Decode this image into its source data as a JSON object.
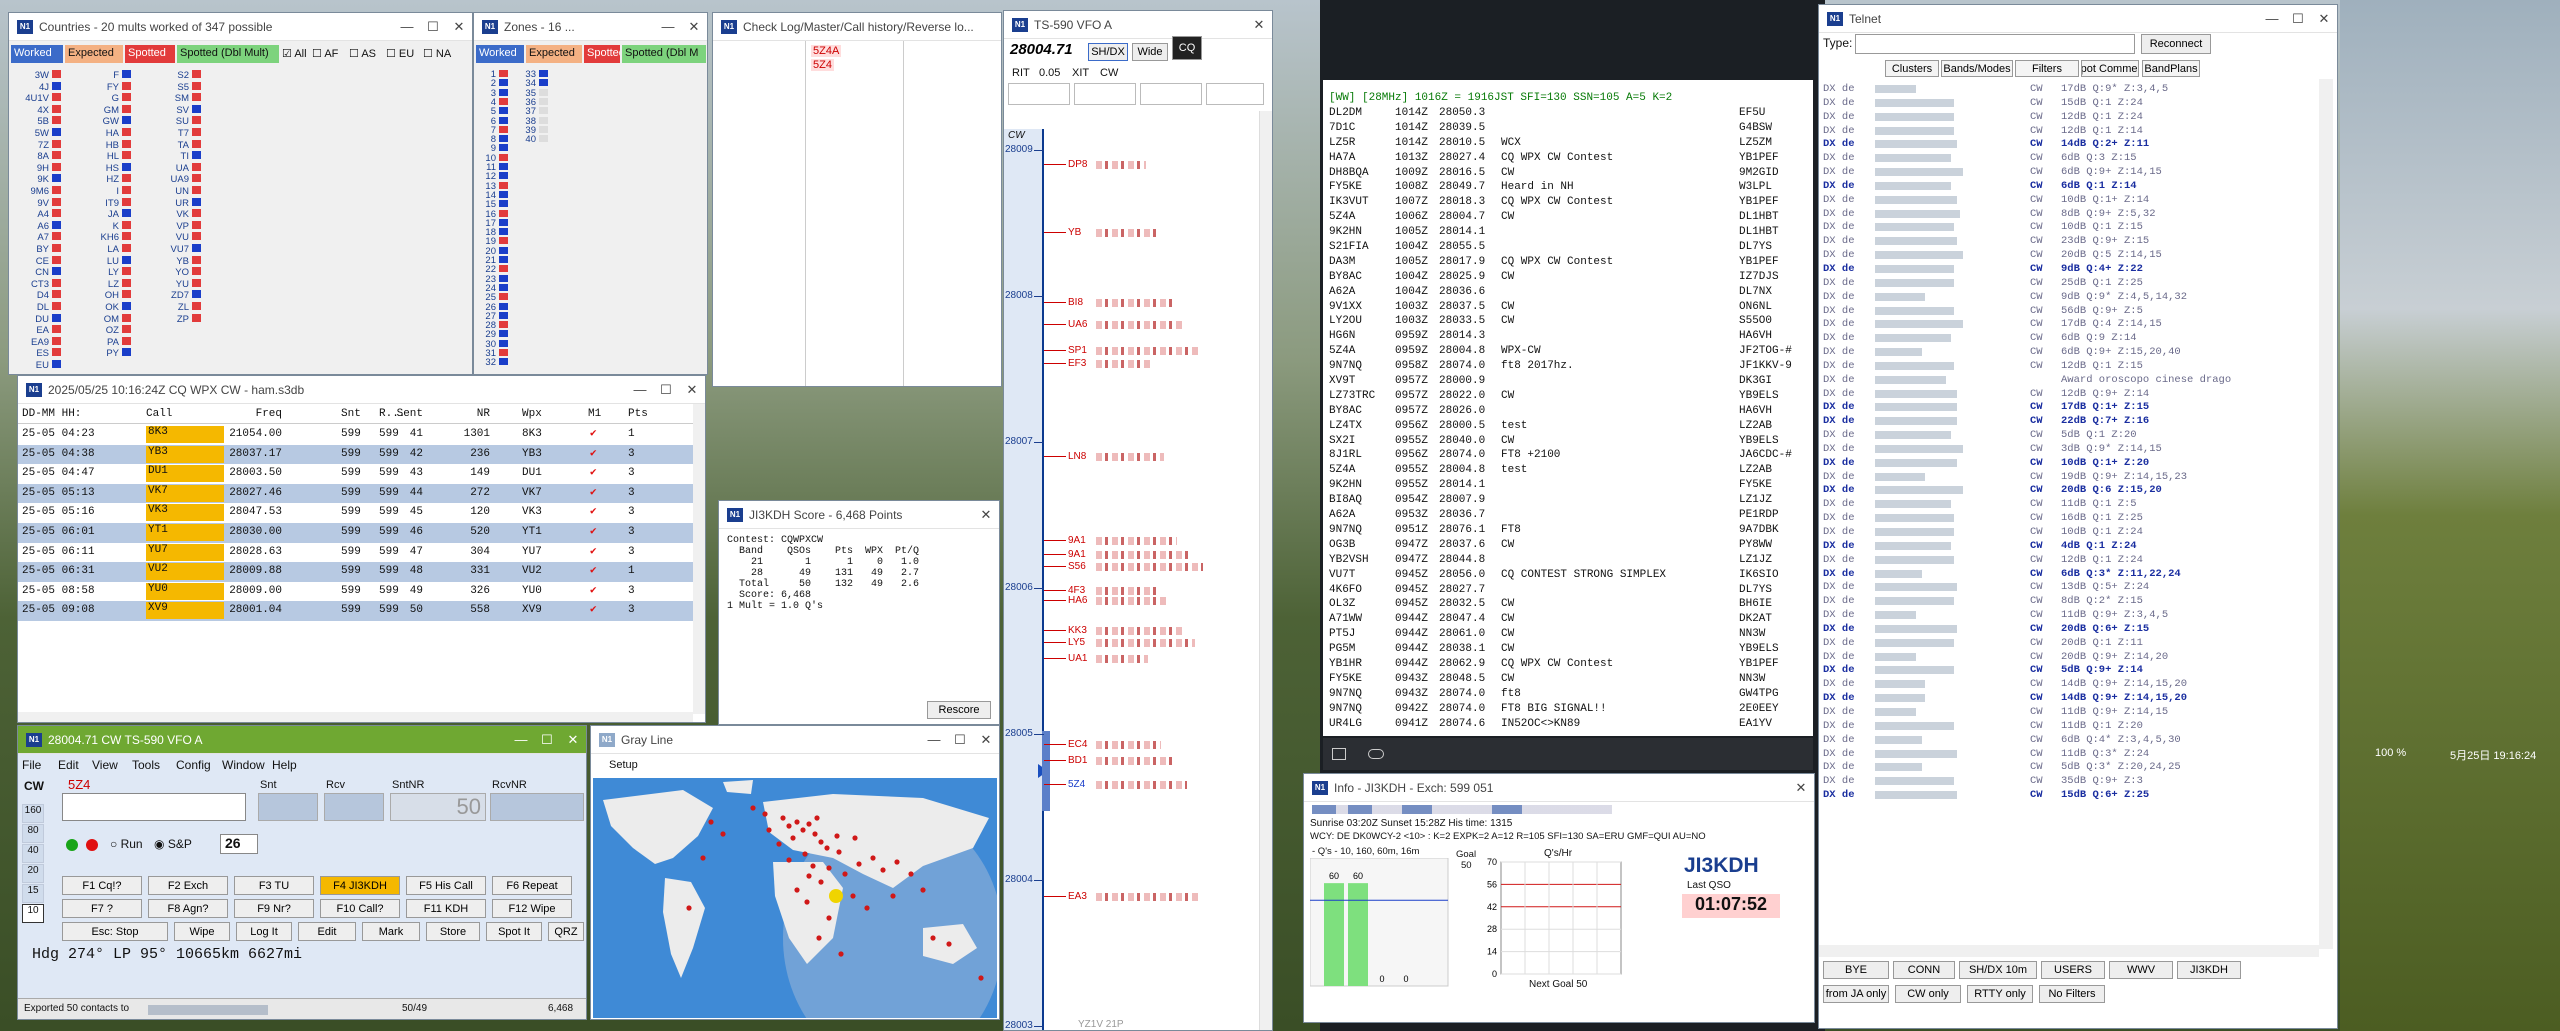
{
  "colors": {
    "accent": "#1a3e8f",
    "green_title": "#6fa832",
    "row_sel": "#b7c9e2",
    "call_hi": "#f5b800",
    "check_red": "#e01010",
    "red": "#c00000"
  },
  "countries": {
    "title": "Countries - 20 mults worked of 347 possible",
    "filters": [
      "Worked",
      "Expected",
      "Spotted",
      "Spotted (Dbl Mult)",
      "All",
      "AF",
      "AS",
      "EU",
      "NA"
    ],
    "col1": [
      "3W",
      "4J",
      "4U1V",
      "4X",
      "5B",
      "5W",
      "7Z",
      "8A",
      "9H",
      "9K",
      "9M6",
      "9V",
      "A4",
      "A6",
      "A7",
      "BY",
      "CE",
      "CN",
      "CT3",
      "D4",
      "DL",
      "DU",
      "EA",
      "EA9",
      "ES",
      "EU"
    ],
    "col2": [
      "F",
      "FY",
      "G",
      "GM",
      "GW",
      "HA",
      "HB",
      "HL",
      "HS",
      "HZ",
      "I",
      "IT9",
      "JA",
      "K",
      "KH6",
      "LA",
      "LU",
      "LY",
      "LZ",
      "OH",
      "OK",
      "OM",
      "OZ",
      "PA",
      "PY"
    ],
    "col3": [
      "S2",
      "S5",
      "SM",
      "SV",
      "SU",
      "T7",
      "TA",
      "TI",
      "UA",
      "UA9",
      "UN",
      "UR",
      "VK",
      "VP",
      "VU",
      "VU7",
      "YB",
      "YO",
      "YU",
      "ZD7",
      "ZL",
      "ZP"
    ]
  },
  "zones": {
    "title": "Zones - 16 ...",
    "filters": [
      "Worked",
      "Expected",
      "Spotted",
      "Spotted (Dbl M"
    ],
    "col1": [
      "1",
      "2",
      "3",
      "4",
      "5",
      "6",
      "7",
      "8",
      "9",
      "10",
      "11",
      "12",
      "13",
      "14",
      "15",
      "16",
      "17",
      "18",
      "19",
      "20",
      "21",
      "22",
      "23",
      "24",
      "25",
      "26",
      "27",
      "28",
      "29",
      "30",
      "31",
      "32"
    ],
    "col2": [
      "33",
      "34",
      "35",
      "36",
      "37",
      "38",
      "39",
      "40"
    ]
  },
  "checklog": {
    "title": "Check Log/Master/Call history/Reverse lo...",
    "items": [
      "5Z4A",
      "5Z4"
    ]
  },
  "bandmap": {
    "title": "TS-590 VFO A",
    "freq": "28004.71",
    "btn_shdx": "SH/DX",
    "btn_wide": "Wide",
    "btn_cq": "CQ",
    "rit": "RIT",
    "rit_val": "0.05",
    "xit": "XIT",
    "mode": "CW",
    "mode_label": "CW",
    "ticks": [
      "28009",
      "28008",
      "28007",
      "28006",
      "28005",
      "28004",
      "28003"
    ],
    "spots": [
      "DP8",
      "YB",
      "BI8",
      "UA6",
      "SP1",
      "EF3",
      "LN8",
      "9A1",
      "9A1",
      "S56",
      "4F3",
      "HA6",
      "KK3",
      "LY5",
      "UA1",
      "EC4",
      "BD1",
      "5Z4",
      "EA3"
    ],
    "bottom": "YZ1V 21P"
  },
  "log": {
    "title": "2025/05/25 10:16:24Z  CQ WPX  CW - ham.s3db",
    "headers": [
      "DD-MM  HH:MM",
      "Call",
      "Freq",
      "Snt",
      "R...",
      "Sent",
      "NR",
      "Wpx",
      "M1",
      "Pts"
    ],
    "rows": [
      {
        "dt": "25-05 04:23",
        "call": "8K3",
        "freq": "21054.00",
        "snt": "599",
        "rcv": "599",
        "sent": "41",
        "nr": "1301",
        "wpx": "8K3",
        "pts": "1"
      },
      {
        "dt": "25-05 04:38",
        "call": "YB3",
        "freq": "28037.17",
        "snt": "599",
        "rcv": "599",
        "sent": "42",
        "nr": "236",
        "wpx": "YB3",
        "pts": "3"
      },
      {
        "dt": "25-05 04:47",
        "call": "DU1",
        "freq": "28003.50",
        "snt": "599",
        "rcv": "599",
        "sent": "43",
        "nr": "149",
        "wpx": "DU1",
        "pts": "3"
      },
      {
        "dt": "25-05 05:13",
        "call": "VK7",
        "freq": "28027.46",
        "snt": "599",
        "rcv": "599",
        "sent": "44",
        "nr": "272",
        "wpx": "VK7",
        "pts": "3"
      },
      {
        "dt": "25-05 05:16",
        "call": "VK3",
        "freq": "28047.53",
        "snt": "599",
        "rcv": "599",
        "sent": "45",
        "nr": "120",
        "wpx": "VK3",
        "pts": "3"
      },
      {
        "dt": "25-05 06:01",
        "call": "YT1",
        "freq": "28030.00",
        "snt": "599",
        "rcv": "599",
        "sent": "46",
        "nr": "520",
        "wpx": "YT1",
        "pts": "3"
      },
      {
        "dt": "25-05 06:11",
        "call": "YU7",
        "freq": "28028.63",
        "snt": "599",
        "rcv": "599",
        "sent": "47",
        "nr": "304",
        "wpx": "YU7",
        "pts": "3"
      },
      {
        "dt": "25-05 06:31",
        "call": "VU2",
        "freq": "28009.88",
        "snt": "599",
        "rcv": "599",
        "sent": "48",
        "nr": "331",
        "wpx": "VU2",
        "pts": "1"
      },
      {
        "dt": "25-05 08:58",
        "call": "YU0",
        "freq": "28009.00",
        "snt": "599",
        "rcv": "599",
        "sent": "49",
        "nr": "326",
        "wpx": "YU0",
        "pts": "3"
      },
      {
        "dt": "25-05 09:08",
        "call": "XV9",
        "freq": "28001.04",
        "snt": "599",
        "rcv": "599",
        "sent": "50",
        "nr": "558",
        "wpx": "XV9",
        "pts": "3"
      }
    ]
  },
  "score": {
    "title": "JI3KDH Score - 6,468 Points",
    "lines": [
      "Contest: CQWPXCW",
      "  Band    QSOs    Pts  WPX  Pt/Q",
      "    21       1      1    0   1.0",
      "    28      49    131   49   2.7",
      "  Total     50    132   49   2.6",
      "  Score: 6,468",
      "1 Mult = 1.0 Q's"
    ],
    "rescore": "Rescore"
  },
  "entry": {
    "title": "28004.71 CW TS-590 VFO A",
    "menu": [
      "File",
      "Edit",
      "View",
      "Tools",
      "Config",
      "Window",
      "Help"
    ],
    "callsign": "5Z4",
    "labels": [
      "Snt",
      "Rcv",
      "SntNR",
      "RcvNR"
    ],
    "sntnr": "50",
    "mode": "CW",
    "bands": [
      "160",
      "80",
      "40",
      "20",
      "15",
      "10"
    ],
    "run": "Run",
    "sp": "S&P",
    "spin": "26",
    "fkeys": [
      "F1 Cq!?",
      "F2 Exch",
      "F3 TU",
      "F4 JI3KDH",
      "F5 His Call",
      "F6 Repeat",
      "F7 ?",
      "F8 Agn?",
      "F9 Nr?",
      "F10 Call?",
      "F11 KDH",
      "F12 Wipe"
    ],
    "actions": [
      "Esc: Stop",
      "Wipe",
      "Log It",
      "Edit",
      "Mark",
      "Store",
      "Spot It",
      "QRZ"
    ],
    "heading": "Hdg 274° LP 95° 10665km 6627mi",
    "status": "Exported 50 contacts to",
    "count": "50/49",
    "pts": "6,468"
  },
  "grayline": {
    "title": "Gray Line",
    "setup": "Setup"
  },
  "cluster": {
    "header": "[WW] [28MHz] 1016Z = 1916JST  SFI=130 SSN=105 A=5 K=2",
    "rows": [
      [
        "DL2DM",
        "1014Z",
        "28050.3",
        "",
        "EF5U"
      ],
      [
        "7D1C",
        "1014Z",
        "28039.5",
        "",
        "G4BSW"
      ],
      [
        "LZ5R",
        "1014Z",
        "28010.5",
        "WCX",
        "LZ5ZM"
      ],
      [
        "HA7A",
        "1013Z",
        "28027.4",
        "CQ WPX CW Contest",
        "YB1PEF"
      ],
      [
        "DH8BQA",
        "1009Z",
        "28016.5",
        "CW",
        "9M2GID"
      ],
      [
        "FY5KE",
        "1008Z",
        "28049.7",
        "Heard in NH",
        "W3LPL"
      ],
      [
        "IK3VUT",
        "1007Z",
        "28018.3",
        "CQ WPX CW Contest",
        "YB1PEF"
      ],
      [
        "5Z4A",
        "1006Z",
        "28004.7",
        "CW",
        "DL1HBT"
      ],
      [
        "9K2HN",
        "1005Z",
        "28014.1",
        "",
        "DL1HBT"
      ],
      [
        "S21FIA",
        "1004Z",
        "28055.5",
        "",
        "DL7YS"
      ],
      [
        "DA3M",
        "1005Z",
        "28017.9",
        "CQ WPX CW Contest",
        "YB1PEF"
      ],
      [
        "BY8AC",
        "1004Z",
        "28025.9",
        "CW",
        "IZ7DJS"
      ],
      [
        "A62A",
        "1004Z",
        "28036.6",
        "",
        "DL7NX"
      ],
      [
        "9V1XX",
        "1003Z",
        "28037.5",
        "CW",
        "ON6NL"
      ],
      [
        "LY2OU",
        "1003Z",
        "28033.5",
        "CW",
        "S55O0"
      ],
      [
        "HG6N",
        "0959Z",
        "28014.3",
        "",
        "HA6VH"
      ],
      [
        "5Z4A",
        "0959Z",
        "28004.8",
        "WPX-CW",
        "JF2TOG-#"
      ],
      [
        "9N7NQ",
        "0958Z",
        "28074.0",
        "ft8 2017hz.",
        "JF1KKV-9"
      ],
      [
        "XV9T",
        "0957Z",
        "28000.9",
        "",
        "DK3GI"
      ],
      [
        "LZ73TRC",
        "0957Z",
        "28022.0",
        "CW",
        "YB9ELS"
      ],
      [
        "BY8AC",
        "0957Z",
        "28026.0",
        "",
        "HA6VH"
      ],
      [
        "LZ4TX",
        "0956Z",
        "28000.5",
        "test",
        "LZ2AB"
      ],
      [
        "SX2I",
        "0955Z",
        "28040.0",
        "CW",
        "YB9ELS"
      ],
      [
        "8J1RL",
        "0956Z",
        "28074.0",
        "FT8 +2100",
        "JA6CDC-#"
      ],
      [
        "5Z4A",
        "0955Z",
        "28004.8",
        "test",
        "LZ2AB"
      ],
      [
        "9K2HN",
        "0955Z",
        "28014.1",
        "",
        "FY5KE"
      ],
      [
        "BI8AQ",
        "0954Z",
        "28007.9",
        "",
        "LZ1JZ"
      ],
      [
        "A62A",
        "0953Z",
        "28036.7",
        "",
        "PE1RDP"
      ],
      [
        "9N7NQ",
        "0951Z",
        "28076.1",
        "FT8",
        "9A7DBK"
      ],
      [
        "OG3B",
        "0947Z",
        "28037.6",
        "CW",
        "PY8WW"
      ],
      [
        "YB2VSH",
        "0947Z",
        "28044.8",
        "",
        "LZ1JZ"
      ],
      [
        "VU7T",
        "0945Z",
        "28056.0",
        "CQ CONTEST STRONG SIMPLEX",
        "IK6SIO"
      ],
      [
        "4K6FO",
        "0945Z",
        "28027.7",
        "",
        "DL7YS"
      ],
      [
        "OL3Z",
        "0945Z",
        "28032.5",
        "CW",
        "BH6IE"
      ],
      [
        "A71WW",
        "0944Z",
        "28047.4",
        "CW",
        "DK2AT"
      ],
      [
        "PT5J",
        "0944Z",
        "28061.0",
        "CW",
        "NN3W"
      ],
      [
        "PG5M",
        "0944Z",
        "28038.1",
        "CW",
        "YB9ELS"
      ],
      [
        "YB1HR",
        "0944Z",
        "28062.9",
        "CQ WPX CW Contest",
        "YB1PEF"
      ],
      [
        "FY5KE",
        "0943Z",
        "28048.5",
        "CW",
        "NN3W"
      ],
      [
        "9N7NQ",
        "0943Z",
        "28074.0",
        "ft8",
        "GW4TPG"
      ],
      [
        "9N7NQ",
        "0942Z",
        "28074.0",
        "FT8 BIG SIGNAL!!",
        "2E0EEY"
      ],
      [
        "UR4LG",
        "0941Z",
        "28074.6",
        "IN52OC<>KN89",
        "EA1YV"
      ]
    ]
  },
  "info": {
    "title": "Info - JI3KDH - Exch: 599 051",
    "sun": "Sunrise 03:20Z Sunset 15:28Z His time: 1315",
    "wcy": "WCY: DE DK0WCY-2 <10> : K=2 EXPK=2 A=12 R=105 SFI=130 SA=ERU GMF=QUI AU=NO",
    "qs_label": "- Q's - 10, 160, 60m, 16m",
    "goal_label": "Goal",
    "goal": "50",
    "bars": [
      60,
      60,
      0,
      0
    ],
    "bar_labels": [
      "60",
      "60",
      "0",
      "0"
    ],
    "rate_label": "Q's/Hr",
    "rate_ticks": [
      "70",
      "56",
      "42",
      "28",
      "14",
      "0"
    ],
    "next_goal": "Next Goal 50",
    "callsign": "JI3KDH",
    "last_qso": "Last QSO",
    "timer": "01:07:52"
  },
  "telnet": {
    "title": "Telnet",
    "type_label": "Type:",
    "reconnect": "Reconnect",
    "tabs": [
      "Clusters",
      "Bands/Modes",
      "Filters",
      "Spot Comment",
      "BandPlans"
    ],
    "lines": [
      [
        "CW",
        "17dB Q:9* Z:3,4,5",
        0
      ],
      [
        "CW",
        "15dB Q:1 Z:24",
        0
      ],
      [
        "CW",
        "12dB Q:1 Z:24",
        0
      ],
      [
        "CW",
        "12dB Q:1 Z:14",
        0
      ],
      [
        "CW",
        "14dB Q:2+ Z:11",
        1
      ],
      [
        "CW",
        "6dB Q:3 Z:15",
        0
      ],
      [
        "CW",
        "6dB Q:9+ Z:14,15",
        0
      ],
      [
        "CW",
        "6dB Q:1 Z:14",
        1
      ],
      [
        "CW",
        "10dB Q:1+ Z:14",
        0
      ],
      [
        "CW",
        "8dB Q:9+ Z:5,32",
        0
      ],
      [
        "CW",
        "10dB Q:1 Z:15",
        0
      ],
      [
        "CW",
        "23dB Q:9+ Z:15",
        0
      ],
      [
        "CW",
        "20dB Q:5 Z:14,15",
        0
      ],
      [
        "CW",
        "9dB Q:4+ Z:22",
        1
      ],
      [
        "CW",
        "25dB Q:1 Z:25",
        0
      ],
      [
        "CW",
        "9dB Q:9* Z:4,5,14,32",
        0
      ],
      [
        "CW",
        "56dB Q:9+ Z:5",
        0
      ],
      [
        "CW",
        "17dB Q:4 Z:14,15",
        0
      ],
      [
        "CW",
        "6dB Q:9 Z:14",
        0
      ],
      [
        "CW",
        "6dB Q:9+ Z:15,20,40",
        0
      ],
      [
        "CW",
        "12dB Q:1 Z:15",
        0
      ],
      [
        "",
        "Award oroscopo cinese drago",
        0
      ],
      [
        "CW",
        "12dB Q:9+ Z:14",
        0
      ],
      [
        "CW",
        "17dB Q:1+ Z:15",
        1
      ],
      [
        "CW",
        "22dB Q:7+ Z:16",
        1
      ],
      [
        "CW",
        "5dB Q:1 Z:20",
        0
      ],
      [
        "CW",
        "3dB Q:9* Z:14,15",
        0
      ],
      [
        "CW",
        "10dB Q:1+ Z:20",
        1
      ],
      [
        "CW",
        "19dB Q:9+ Z:14,15,23",
        0
      ],
      [
        "CW",
        "20dB Q:6 Z:15,20",
        1
      ],
      [
        "CW",
        "11dB Q:1 Z:5",
        0
      ],
      [
        "CW",
        "16dB Q:1 Z:25",
        0
      ],
      [
        "CW",
        "10dB Q:1 Z:24",
        0
      ],
      [
        "CW",
        "4dB Q:1 Z:24",
        1
      ],
      [
        "CW",
        "12dB Q:1 Z:24",
        0
      ],
      [
        "CW",
        "6dB Q:3* Z:11,22,24",
        1
      ],
      [
        "CW",
        "13dB Q:5+ Z:24",
        0
      ],
      [
        "CW",
        "8dB Q:2* Z:15",
        0
      ],
      [
        "CW",
        "11dB Q:9+ Z:3,4,5",
        0
      ],
      [
        "CW",
        "20dB Q:6+ Z:15",
        1
      ],
      [
        "CW",
        "20dB Q:1 Z:11",
        0
      ],
      [
        "CW",
        "20dB Q:9+ Z:14,20",
        0
      ],
      [
        "CW",
        "5dB Q:9+ Z:14",
        1
      ],
      [
        "CW",
        "14dB Q:9+ Z:14,15,20",
        0
      ],
      [
        "CW",
        "14dB Q:9+ Z:14,15,20",
        1
      ],
      [
        "CW",
        "11dB Q:9+ Z:14,15",
        0
      ],
      [
        "CW",
        "11dB Q:1 Z:20",
        0
      ],
      [
        "CW",
        "6dB Q:4* Z:3,4,5,30",
        0
      ],
      [
        "CW",
        "11dB Q:3* Z:24",
        0
      ],
      [
        "CW",
        "5dB Q:3* Z:20,24,25",
        0
      ],
      [
        "CW",
        "35dB Q:9+ Z:3",
        0
      ],
      [
        "CW",
        "15dB Q:6+ Z:25",
        1
      ]
    ],
    "buttons": [
      "BYE",
      "CONN",
      "SH/DX 10m",
      "USERS",
      "WWV",
      "JI3KDH",
      "from JA only",
      "CW only",
      "RTTY only",
      "No Filters"
    ]
  },
  "taskbar": {
    "zoom": "100 %",
    "date": "5月25日 19:16:24"
  }
}
